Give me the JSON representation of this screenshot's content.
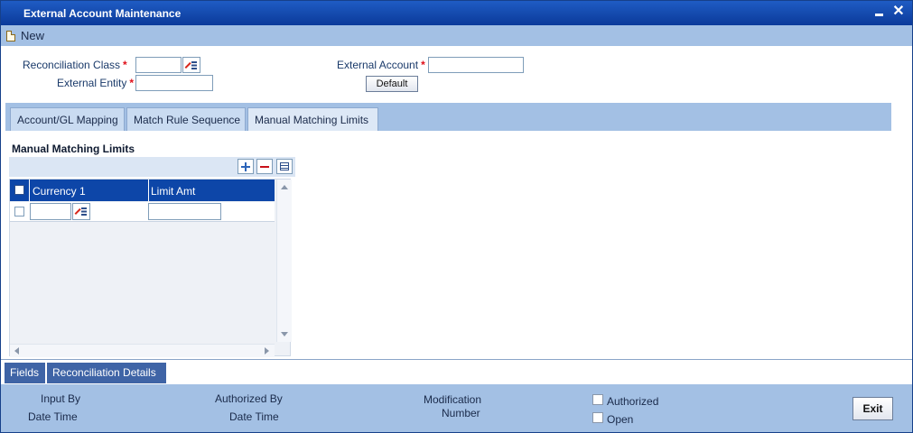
{
  "window": {
    "title": "External Account Maintenance"
  },
  "toolbar": {
    "new_label": "New"
  },
  "form": {
    "reconciliation_class": {
      "label": "Reconciliation Class",
      "value": ""
    },
    "external_entity": {
      "label": "External Entity",
      "value": ""
    },
    "external_account": {
      "label": "External Account",
      "value": ""
    },
    "required_marker": "*",
    "default_button": "Default"
  },
  "tabs": [
    {
      "label": "Account/GL Mapping"
    },
    {
      "label": "Match Rule Sequence"
    },
    {
      "label": "Manual Matching Limits"
    }
  ],
  "section": {
    "title": "Manual Matching Limits"
  },
  "grid": {
    "columns": [
      "Currency 1",
      "Limit Amt"
    ],
    "rows": [
      {
        "currency": "",
        "limit_amt": ""
      }
    ]
  },
  "bottom_tabs": [
    {
      "label": "Fields"
    },
    {
      "label": "Reconciliation Details"
    }
  ],
  "footer": {
    "input_by": "Input By",
    "input_date_time": "Date Time",
    "authorized_by": "Authorized By",
    "authorized_date_time": "Date Time",
    "modification": "Modification",
    "number": "Number",
    "authorized": "Authorized",
    "open": "Open",
    "exit_button": "Exit"
  },
  "colors": {
    "title_bar": "#0b3a9a",
    "toolbar": "#a3c0e4",
    "grid_header": "#0d46a8",
    "required": "#e0101a"
  }
}
